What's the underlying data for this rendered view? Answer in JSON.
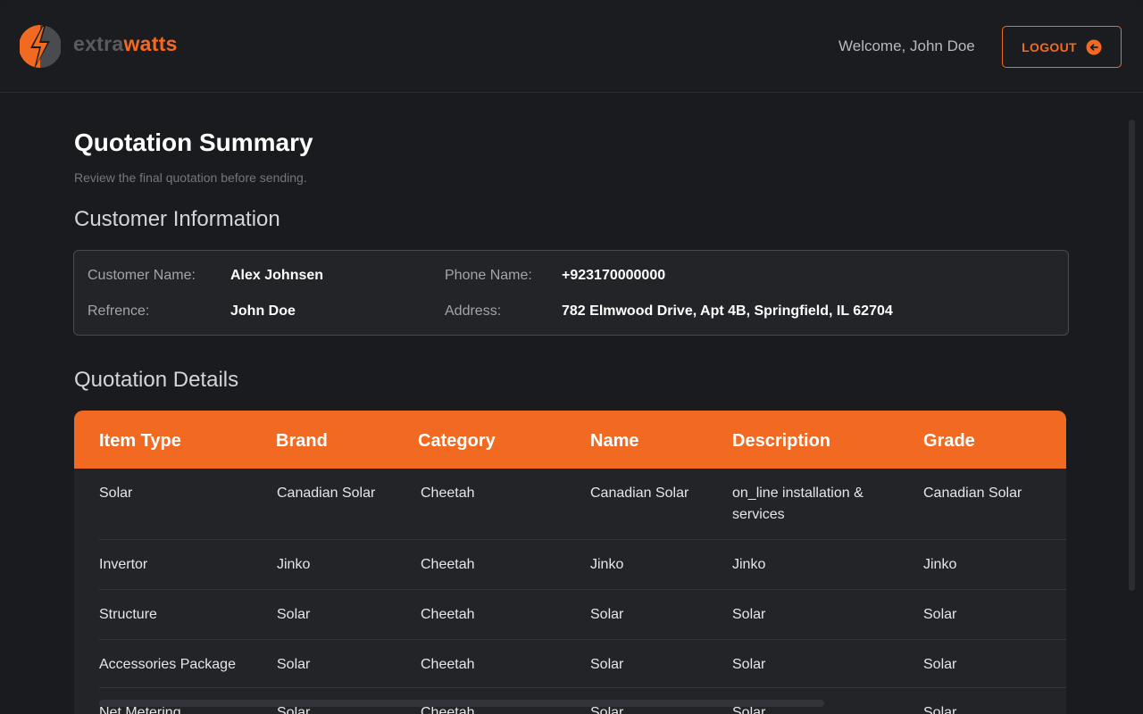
{
  "header": {
    "logo_text_part1": "extra",
    "logo_text_part2": "watts",
    "welcome": "Welcome, John Doe",
    "logout_label": "LOGOUT",
    "accent": "#f26a21"
  },
  "page": {
    "title": "Quotation Summary",
    "subtitle": "Review the final quotation before sending."
  },
  "customer": {
    "section_title": "Customer Information",
    "name_label": "Customer Name:",
    "name_value": "Alex Johnsen",
    "phone_label": "Phone Name:",
    "phone_value": "+923170000000",
    "ref_label": "Refrence:",
    "ref_value": "John Doe",
    "address_label": "Address:",
    "address_value": "782 Elmwood Drive, Apt 4B, Springfield, IL 62704"
  },
  "quotation": {
    "section_title": "Quotation Details",
    "columns": [
      "Item Type",
      "Brand",
      "Category",
      "Name",
      "Description",
      "Grade"
    ],
    "rows": [
      [
        "Solar",
        "Canadian Solar",
        "Cheetah",
        "Canadian Solar",
        "on_line installation & services",
        "Canadian Solar"
      ],
      [
        "Invertor",
        "Jinko",
        "Cheetah",
        "Jinko",
        "Jinko",
        "Jinko"
      ],
      [
        "Structure",
        "Solar",
        "Cheetah",
        "Solar",
        "Solar",
        "Solar"
      ],
      [
        "Accessories Package",
        "Solar",
        "Cheetah",
        "Solar",
        "Solar",
        "Solar"
      ],
      [
        "Net Metering",
        "Solar",
        "Cheetah",
        "Solar",
        "Solar",
        "Solar"
      ]
    ]
  },
  "icons": {
    "logo": "lightning-bolt-icon",
    "logout": "logout-arrow-icon"
  }
}
